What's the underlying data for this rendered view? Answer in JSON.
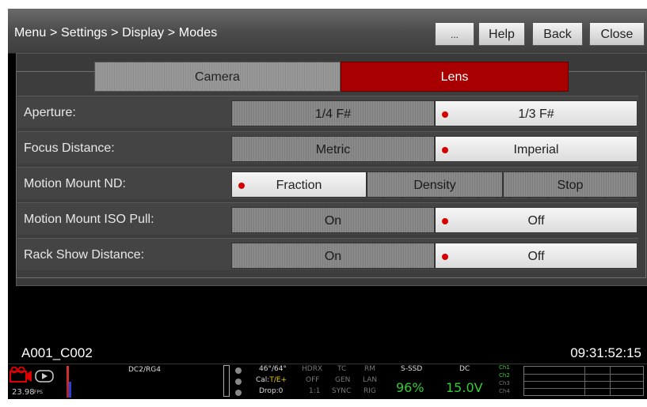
{
  "header": {
    "breadcrumb": "Menu > Settings > Display > Modes",
    "buttons": {
      "more": "...",
      "help": "Help",
      "back": "Back",
      "close": "Close"
    }
  },
  "tabs": [
    {
      "label": "Camera",
      "active": false
    },
    {
      "label": "Lens",
      "active": true
    }
  ],
  "rows": [
    {
      "label": "Aperture:",
      "options": [
        "1/4 F#",
        "1/3 F#"
      ],
      "selected": 1
    },
    {
      "label": "Focus Distance:",
      "options": [
        "Metric",
        "Imperial"
      ],
      "selected": 1
    },
    {
      "label": "Motion Mount ND:",
      "options": [
        "Fraction",
        "Density",
        "Stop"
      ],
      "selected": 0
    },
    {
      "label": "Motion Mount ISO Pull:",
      "options": [
        "On",
        "Off"
      ],
      "selected": 1
    },
    {
      "label": "Rack Show Distance:",
      "options": [
        "On",
        "Off"
      ],
      "selected": 1
    }
  ],
  "clip": {
    "name": "A001_C002",
    "timecode": "09:31:52:15"
  },
  "status": {
    "fps": "23.98",
    "fps_unit": "FPS",
    "codec": "DC2/RG4",
    "temp": "46°/64°",
    "cal_prefix": "Cal:",
    "cal_value": "T/E+",
    "drop": "Drop:0",
    "grid": [
      [
        "HDRX",
        "TC",
        "RM"
      ],
      [
        "OFF",
        "GEN",
        "LAN"
      ],
      [
        "1:1",
        "SYNC",
        "RIG"
      ]
    ],
    "media_label": "S-SSD",
    "media_value": "96%",
    "power_label": "DC",
    "power_value": "15.0V",
    "channels": [
      "Ch1",
      "Ch2",
      "Ch3",
      "Ch4"
    ]
  },
  "colors": {
    "accent": "#a80000",
    "selected_dot": "#d40000",
    "status_green": "#33cc33"
  }
}
